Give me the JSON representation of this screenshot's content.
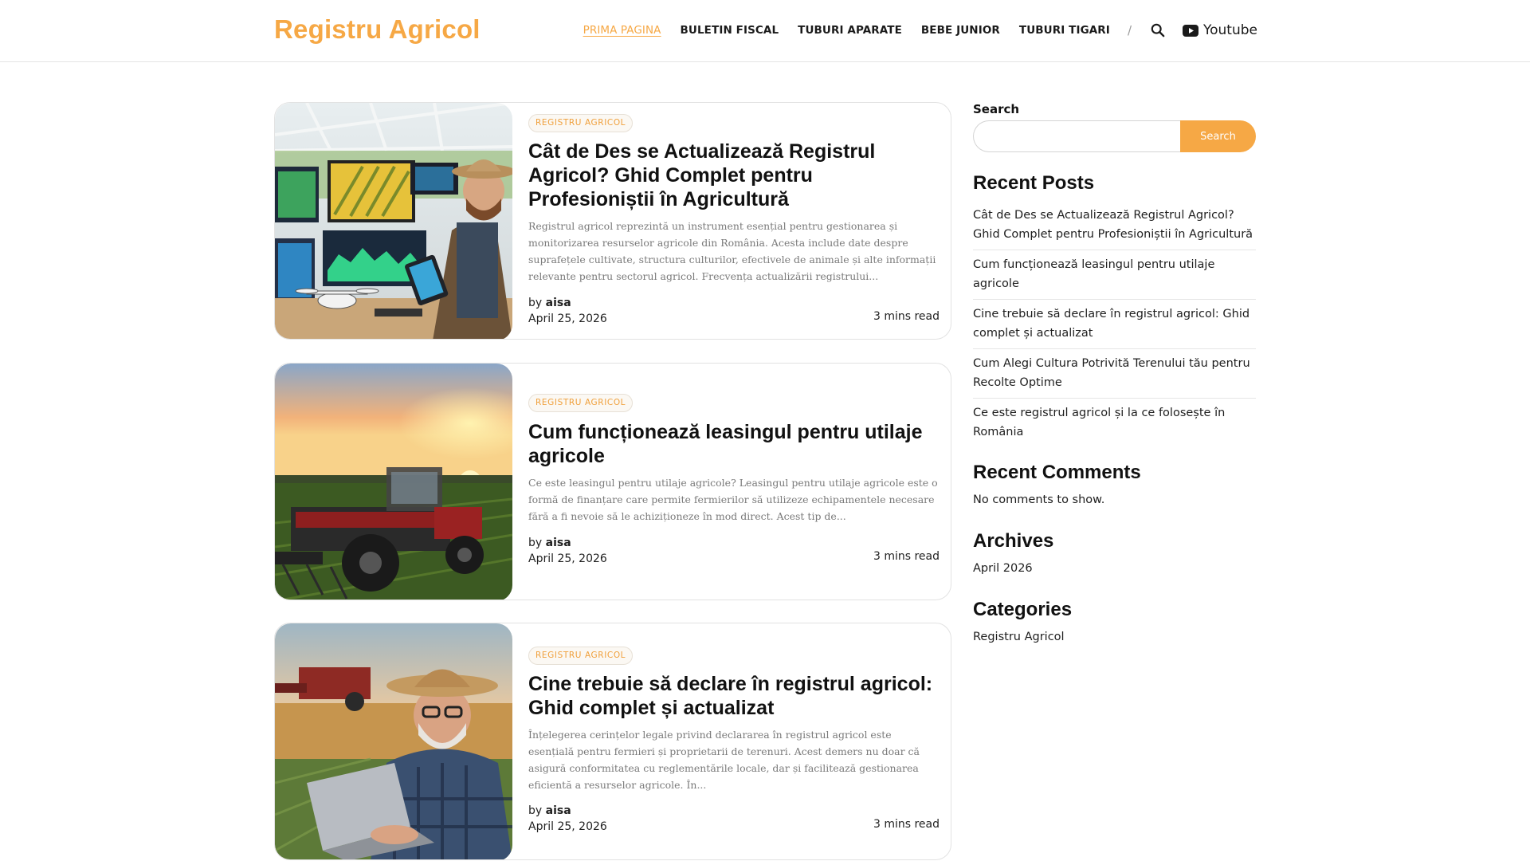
{
  "site": {
    "logo": "Registru Agricol",
    "nav": [
      "PRIMA PAGINA",
      "BULETIN FISCAL",
      "TUBURI APARATE",
      "BEBE JUNIOR",
      "TUBURI TIGARI"
    ],
    "separator": "/",
    "youtube_label": "Youtube",
    "accent_color": "#f6a845"
  },
  "posts": [
    {
      "category": "REGISTRU AGRICOL",
      "title": "Cât de Des se Actualizează Registrul Agricol? Ghid Complet pentru Profesioniștii în Agricultură",
      "excerpt": "Registrul agricol reprezintă un instrument esențial pentru gestionarea și monitorizarea resurselor agricole din România. Acesta include date despre suprafețele cultivate, structura culturilor, efectivele de animale și alte informații relevante pentru sectorul agricol. Frecvența actualizării registrului...",
      "by": "by",
      "author": "aisa",
      "date": "April 25, 2026",
      "read": "3 mins read"
    },
    {
      "category": "REGISTRU AGRICOL",
      "title": "Cum funcționează leasingul pentru utilaje agricole",
      "excerpt": "Ce este leasingul pentru utilaje agricole? Leasingul pentru utilaje agricole este o formă de finanțare care permite fermierilor să utilizeze echipamentele necesare fără a fi nevoie să le achiziționeze în mod direct. Acest tip de...",
      "by": "by",
      "author": "aisa",
      "date": "April 25, 2026",
      "read": "3 mins read"
    },
    {
      "category": "REGISTRU AGRICOL",
      "title": "Cine trebuie să declare în registrul agricol: Ghid complet și actualizat",
      "excerpt": "Înțelegerea cerințelor legale privind declararea în registrul agricol este esențială pentru fermieri și proprietarii de terenuri. Acest demers nu doar că asigură conformitatea cu reglementările locale, dar și facilitează gestionarea eficientă a resurselor agricole. În...",
      "by": "by",
      "author": "aisa",
      "date": "April 25, 2026",
      "read": "3 mins read"
    }
  ],
  "sidebar": {
    "search_label": "Search",
    "search_value": "",
    "search_button": "Search",
    "recent_posts_title": "Recent Posts",
    "recent_posts": [
      "Cât de Des se Actualizează Registrul Agricol? Ghid Complet pentru Profesioniștii în Agricultură",
      "Cum funcționează leasingul pentru utilaje agricole",
      "Cine trebuie să declare în registrul agricol: Ghid complet și actualizat",
      "Cum Alegi Cultura Potrivită Terenului tău pentru Recolte Optime",
      "Ce este registrul agricol și la ce folosește în România"
    ],
    "recent_comments_title": "Recent Comments",
    "no_comments": "No comments to show.",
    "archives_title": "Archives",
    "archives": [
      "April 2026"
    ],
    "categories_title": "Categories",
    "categories": [
      "Registru Agricol"
    ]
  }
}
